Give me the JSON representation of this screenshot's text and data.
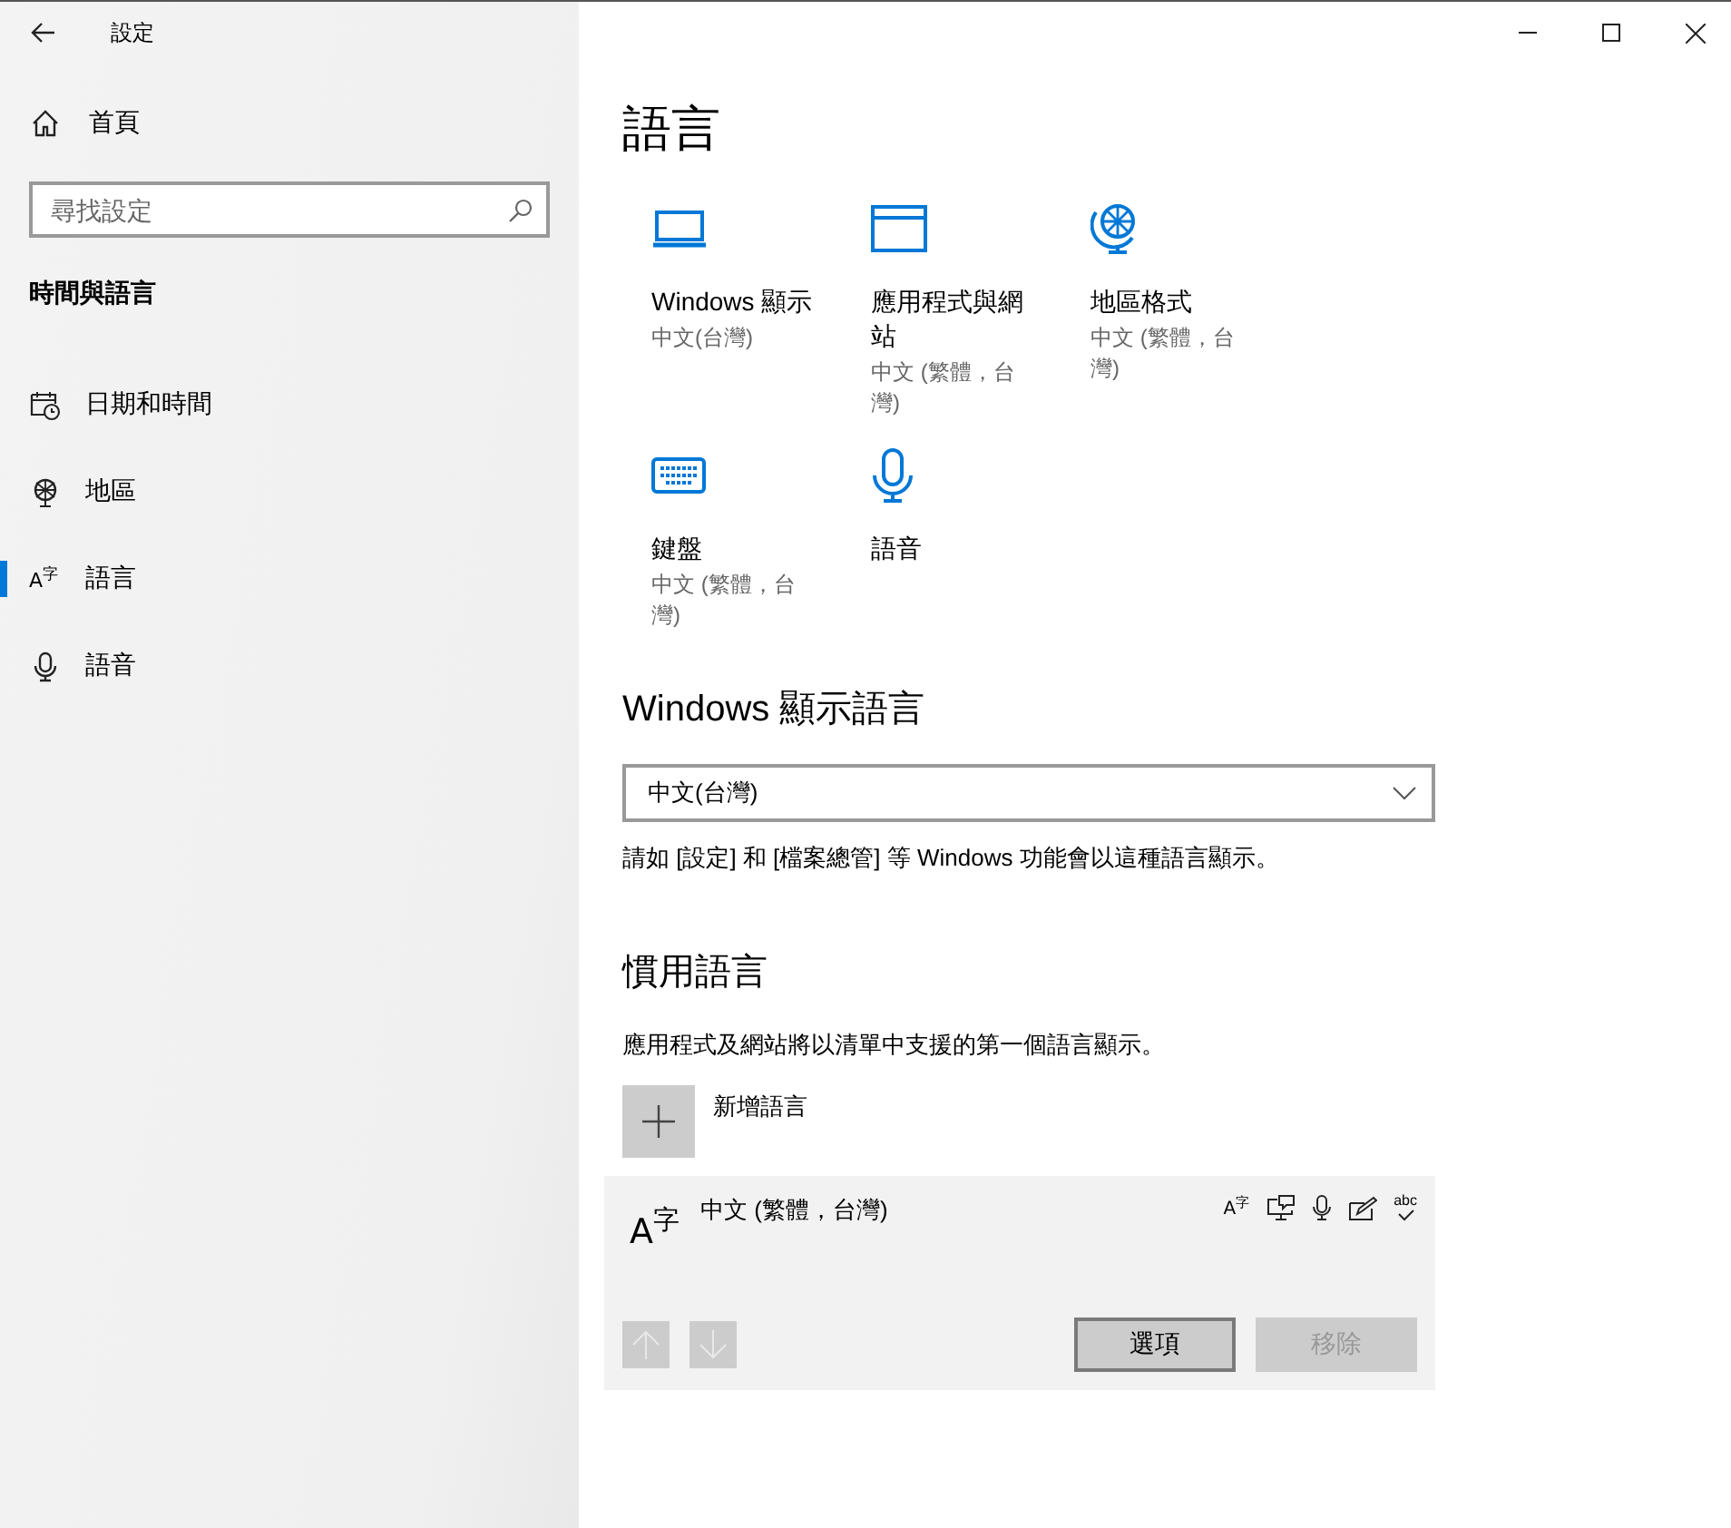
{
  "window": {
    "title": "設定"
  },
  "sidebar": {
    "home": "首頁",
    "search": {
      "placeholder": "尋找設定"
    },
    "section": "時間與語言",
    "items": [
      {
        "label": "日期和時間",
        "kind": "calendar",
        "selected": false
      },
      {
        "label": "地區",
        "kind": "globe",
        "selected": false
      },
      {
        "label": "語言",
        "kind": "language",
        "glyph": "A$^{字}$",
        "selected": true
      },
      {
        "label": "語音",
        "kind": "mic",
        "selected": false
      }
    ]
  },
  "page": {
    "title": "語言",
    "quick_links": [
      {
        "kind": "laptop",
        "title": "Windows 顯示",
        "subtitle": "中文(台灣)"
      },
      {
        "kind": "window",
        "title": "應用程式與網站",
        "subtitle": "中文 (繁體，台灣)"
      },
      {
        "kind": "globe",
        "title": "地區格式",
        "subtitle": "中文 (繁體，台灣)"
      },
      {
        "kind": "keyboard",
        "title": "鍵盤",
        "subtitle": "中文 (繁體，台灣)"
      },
      {
        "kind": "mic",
        "title": "語音"
      }
    ],
    "display_language": {
      "heading": "Windows 顯示語言",
      "value": "中文(台灣)",
      "note": "請如 [設定] 和 [檔案總管] 等 Windows 功能會以這種語言顯示。"
    },
    "preferred": {
      "heading": "慣用語言",
      "note": "應用程式及網站將以清單中支援的第一個語言顯示。",
      "add_label": "新增語言",
      "languages": [
        {
          "name": "中文 (繁體，台灣)",
          "glyph": "A$^{字}$",
          "features": [
            {
              "kind": "language",
              "glyph": "A$^{字}$"
            },
            {
              "kind": "speech"
            },
            {
              "kind": "mic"
            },
            {
              "kind": "handwriting"
            },
            {
              "kind": "spelling",
              "glyph": "abc"
            }
          ],
          "move_up": {
            "disabled": true
          },
          "move_down": {
            "disabled": true
          },
          "buttons": [
            {
              "label": "選項",
              "disabled": false
            },
            {
              "label": "移除",
              "disabled": true
            }
          ]
        }
      ]
    }
  }
}
